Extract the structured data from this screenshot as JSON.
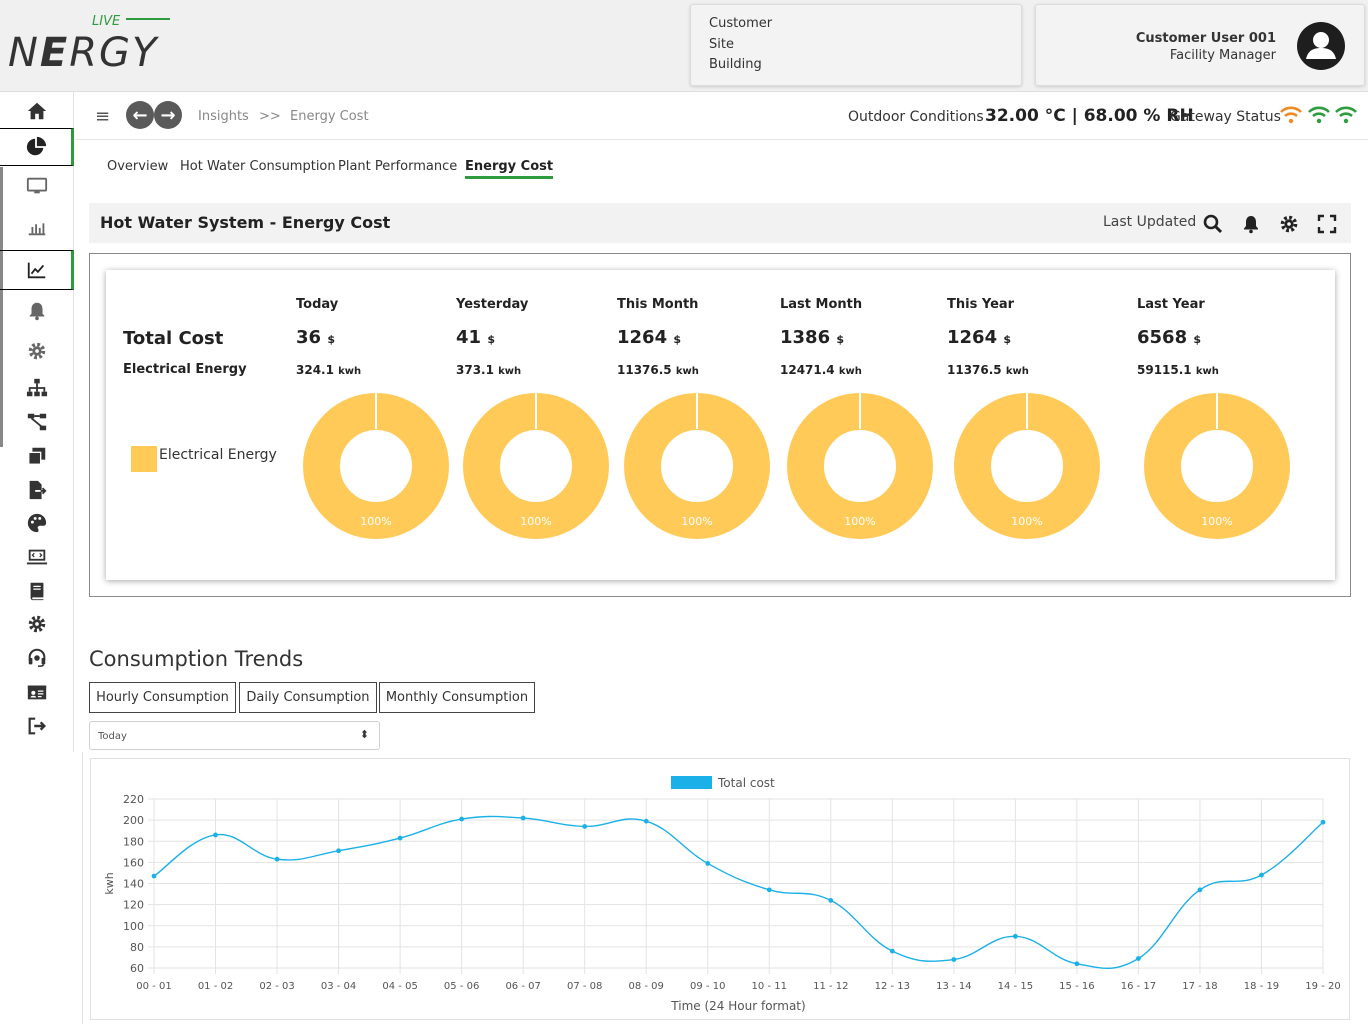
{
  "brand": {
    "live": "LIVE",
    "name_pre": "N",
    "name_e": "E",
    "name_post": "RGY"
  },
  "location": {
    "customer": "Customer",
    "site": "Site",
    "building": "Building"
  },
  "user": {
    "name": "Customer User 001",
    "role": "Facility Manager"
  },
  "breadcrumb": {
    "section": "Insights",
    "separator": ">>",
    "page": "Energy Cost"
  },
  "conditions": {
    "label": "Outdoor Conditions",
    "value": "32.00 °C | 68.00 % RH",
    "gateway_label": "Gateway Status"
  },
  "tabs": [
    {
      "label": "Overview"
    },
    {
      "label": "Hot Water Consumption"
    },
    {
      "label": "Plant Performance"
    },
    {
      "label": "Energy Cost"
    }
  ],
  "panel": {
    "title": "Hot Water System - Energy Cost",
    "last_updated": "Last Updated"
  },
  "cost": {
    "total_label": "Total Cost",
    "energy_label": "Electrical Energy",
    "legend_label": "Electrical Energy",
    "currency": "$",
    "energy_unit": "kwh",
    "columns": [
      {
        "head": "Today",
        "cost": "36",
        "kwh": "324.1",
        "pct": "100%"
      },
      {
        "head": "Yesterday",
        "cost": "41",
        "kwh": "373.1",
        "pct": "100%"
      },
      {
        "head": "This Month",
        "cost": "1264",
        "kwh": "11376.5",
        "pct": "100%"
      },
      {
        "head": "Last Month",
        "cost": "1386",
        "kwh": "12471.4",
        "pct": "100%"
      },
      {
        "head": "This Year",
        "cost": "1264",
        "kwh": "11376.5",
        "pct": "100%"
      },
      {
        "head": "Last Year",
        "cost": "6568",
        "kwh": "59115.1",
        "pct": "100%"
      }
    ]
  },
  "trends": {
    "title": "Consumption Trends",
    "buttons": [
      "Hourly Consumption",
      "Daily Consumption",
      "Monthly Consumption"
    ],
    "period": "Today"
  },
  "colors": {
    "accent": "#2e9b3e",
    "donut": "#ffca58",
    "line": "#1bb0e8",
    "wifi_orange": "#f08a24",
    "wifi_green": "#2e9b3e"
  },
  "chart_data": {
    "type": "line",
    "legend": "Total cost",
    "xlabel": "Time (24 Hour format)",
    "ylabel": "kwh",
    "ylim": [
      60,
      220
    ],
    "yticks": [
      60,
      80,
      100,
      120,
      140,
      160,
      180,
      200,
      220
    ],
    "categories": [
      "00 - 01",
      "01 - 02",
      "02 - 03",
      "03 - 04",
      "04 - 05",
      "05 - 06",
      "06 - 07",
      "07 - 08",
      "08 - 09",
      "09 - 10",
      "10 - 11",
      "11 - 12",
      "12 - 13",
      "13 - 14",
      "14 - 15",
      "15 - 16",
      "16 - 17",
      "17 - 18",
      "18 - 19",
      "19 - 20"
    ],
    "series": [
      {
        "name": "Total cost",
        "values": [
          147,
          186,
          163,
          171,
          183,
          201,
          202,
          194,
          199,
          159,
          134,
          124,
          76,
          68,
          90,
          64,
          69,
          134,
          148,
          198
        ]
      }
    ],
    "grid": true,
    "legend_position": "top-center"
  }
}
